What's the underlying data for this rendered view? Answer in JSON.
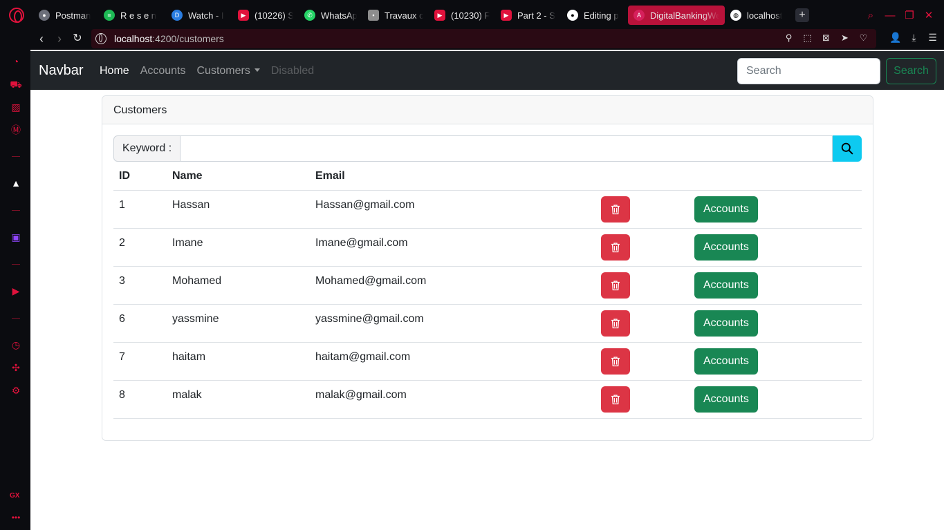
{
  "browser": {
    "tabs": [
      {
        "label": "Postman",
        "icon": "postman-icon",
        "color": "#6c6f7a"
      },
      {
        "label": "R e s e n",
        "icon": "spotify-icon",
        "color": "#1db954"
      },
      {
        "label": "Watch - I",
        "icon": "disney-icon",
        "color": "#2a7de1"
      },
      {
        "label": "(10226) S",
        "icon": "youtube-icon",
        "color": "#e0123c"
      },
      {
        "label": "WhatsAp",
        "icon": "whatsapp-icon",
        "color": "#25d366"
      },
      {
        "label": "Travaux c",
        "icon": "classroom-icon",
        "color": "#8d8d8d"
      },
      {
        "label": "(10230) F",
        "icon": "youtube-icon",
        "color": "#e0123c"
      },
      {
        "label": "Part 2 - S",
        "icon": "youtube-icon",
        "color": "#e0123c"
      },
      {
        "label": "Editing p",
        "icon": "github-icon",
        "color": "#ffffff"
      },
      {
        "label": "DigitalBankingWe",
        "icon": "angular-icon",
        "color": "#d6205c",
        "active": true
      },
      {
        "label": "localhost",
        "icon": "globe-icon",
        "color": "#ffffff"
      }
    ],
    "url_host": "localhost",
    "url_path": ":4200/customers"
  },
  "navbar": {
    "brand": "Navbar",
    "links": [
      "Home",
      "Accounts",
      "Customers",
      "Disabled"
    ],
    "search_placeholder": "Search",
    "search_button": "Search"
  },
  "card": {
    "title": "Customers",
    "keyword_label": "Keyword :",
    "keyword_value": ""
  },
  "table": {
    "headers": [
      "ID",
      "Name",
      "Email"
    ],
    "rows": [
      {
        "id": "1",
        "name": "Hassan",
        "email": "Hassan@gmail.com"
      },
      {
        "id": "2",
        "name": "Imane",
        "email": "Imane@gmail.com"
      },
      {
        "id": "3",
        "name": "Mohamed",
        "email": "Mohamed@gmail.com"
      },
      {
        "id": "6",
        "name": "yassmine",
        "email": "yassmine@gmail.com"
      },
      {
        "id": "7",
        "name": "haitam",
        "email": "haitam@gmail.com"
      },
      {
        "id": "8",
        "name": "malak",
        "email": "malak@gmail.com"
      }
    ],
    "accounts_button": "Accounts"
  },
  "sidebar": {
    "gx_label": "GX"
  },
  "colors": {
    "navbar_bg": "#212529",
    "danger": "#dc3545",
    "success": "#198754",
    "info": "#0dcaf0",
    "opera_accent": "#e0123c"
  }
}
